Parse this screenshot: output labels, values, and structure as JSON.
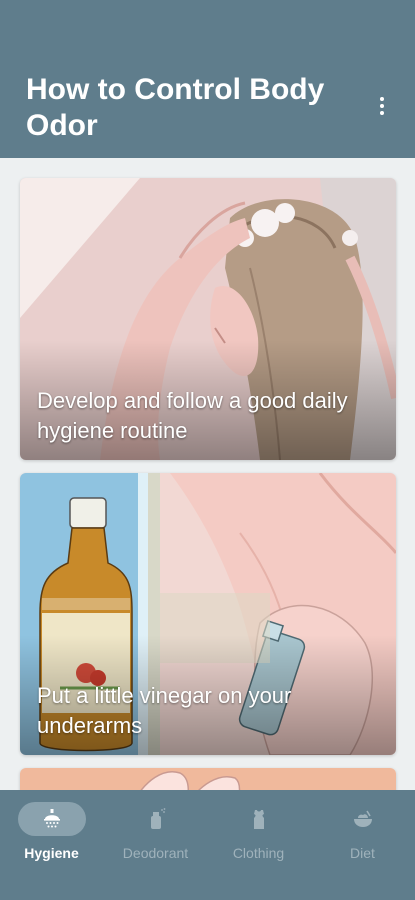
{
  "header": {
    "title": "How to Control Body Odor",
    "menu_icon": "more-vertical-icon"
  },
  "cards": [
    {
      "caption": "Develop and follow a good daily hygiene routine",
      "image": "woman-washing-hair-illustration"
    },
    {
      "caption": "Put a little vinegar on your underarms",
      "image": "vinegar-bottle-and-underarm-spray-illustration"
    },
    {
      "caption": "",
      "image": "partial-hands-illustration"
    }
  ],
  "bottom_nav": {
    "items": [
      {
        "label": "Hygiene",
        "icon": "shower-icon",
        "active": true
      },
      {
        "label": "Deodorant",
        "icon": "spray-bottle-icon",
        "active": false
      },
      {
        "label": "Clothing",
        "icon": "shirt-icon",
        "active": false
      },
      {
        "label": "Diet",
        "icon": "food-bowl-icon",
        "active": false
      }
    ]
  },
  "colors": {
    "primary": "#5f7d8c",
    "background": "#edf0f1",
    "nav_active_pill": "#8aa2ae",
    "nav_inactive_text": "#9fb2bb"
  }
}
